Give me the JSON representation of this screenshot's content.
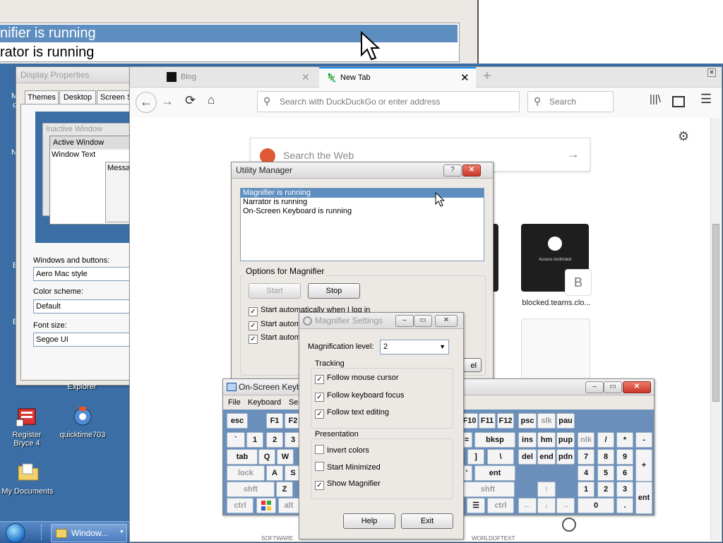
{
  "magnified": {
    "line1": "nifier is running",
    "line2": "rator is running"
  },
  "display_props": {
    "title": "Display Properties",
    "tabs": [
      "Themes",
      "Desktop",
      "Screen S"
    ],
    "preview": {
      "inactive": "Inactive Window",
      "active": "Active Window",
      "window_text": "Window Text",
      "message": "Messa"
    },
    "windows_buttons_label": "Windows and buttons:",
    "windows_buttons_value": "Aero Mac style",
    "color_scheme_label": "Color scheme:",
    "color_scheme_value": "Default",
    "font_size_label": "Font size:",
    "font_size_value": "Segoe UI"
  },
  "desktop": {
    "left_letters": [
      "M",
      "c",
      "N",
      "E",
      "E"
    ],
    "explorer_label": "Explorer",
    "icons": [
      {
        "label": "Register Bryce 4",
        "icon": "installer-icon"
      },
      {
        "label": "quicktime703",
        "icon": "quicktime-icon"
      },
      {
        "label": "My Documents",
        "icon": "folder-icon"
      }
    ]
  },
  "browser": {
    "tabs": [
      {
        "title": "Blog"
      },
      {
        "title": "New Tab"
      }
    ],
    "address_placeholder": "Search with DuckDuckGo or enter address",
    "search_placeholder": "Search",
    "web_search_placeholder": "Search the Web",
    "tile_label": "blocked.teams.clo...",
    "tile_overlay": "Access restricted",
    "tile_badge": "B",
    "footer_left": "SOFTWARE",
    "footer_right": "WORLDOFTEXT"
  },
  "utility": {
    "title": "Utility Manager",
    "help_glyph": "?",
    "items": [
      "Magnifier is running",
      "Narrator is running",
      "On-Screen Keyboard is running"
    ],
    "options_label": "Options for Magnifier",
    "start": "Start",
    "stop": "Stop",
    "cb1": "Start automatically when I log in",
    "cb2": "Start autom",
    "cb3": "Start autom",
    "cancel_fragment": "el"
  },
  "magnifier": {
    "title": "Magnifier Settings",
    "level_label": "Magnification level:",
    "level_value": "2",
    "tracking_label": "Tracking",
    "follow_mouse": "Follow mouse cursor",
    "follow_keyboard": "Follow keyboard focus",
    "follow_text": "Follow text editing",
    "presentation_label": "Presentation",
    "invert": "Invert colors",
    "start_min": "Start Minimized",
    "show_mag": "Show Magnifier",
    "help": "Help",
    "exit": "Exit"
  },
  "osk": {
    "title": "On-Screen Keybo",
    "menu": [
      "File",
      "Keyboard",
      "Se"
    ],
    "keys": {
      "esc": "esc",
      "f1": "F1",
      "f2": "F2",
      "f10": "F10",
      "f11": "F11",
      "f12": "F12",
      "psc": "psc",
      "slk": "slk",
      "pau": "pau",
      "grave": "`",
      "n1": "1",
      "n2": "2",
      "n3": "3",
      "eq": "=",
      "bksp": "bksp",
      "ins": "ins",
      "hm": "hm",
      "pup": "pup",
      "nlk": "nlk",
      "div": "/",
      "mul": "*",
      "sub": "-",
      "tab": "tab",
      "q": "Q",
      "w": "W",
      "rbr": "]",
      "bsl": "\\",
      "del": "del",
      "end": "end",
      "pdn": "pdn",
      "np7": "7",
      "np8": "8",
      "np9": "9",
      "add": "+",
      "lock": "lock",
      "a": "A",
      "s": "S",
      "quote": "'",
      "ent": "ent",
      "np4": "4",
      "np5": "5",
      "np6": "6",
      "shft": "shft",
      "z": "Z",
      "shft_r": "shft",
      "np1": "1",
      "np2": "2",
      "np3": "3",
      "np_ent": "ent",
      "ctrl": "ctrl",
      "alt": "alt",
      "ctrl_r": "ctrl",
      "np0": "0",
      "dot": "."
    }
  },
  "taskbar": {
    "task_label": "Window..."
  },
  "colors": {
    "desktop": "#3a6ea5",
    "selection": "#5e8ec0",
    "osk_bg": "#6a8fba"
  }
}
